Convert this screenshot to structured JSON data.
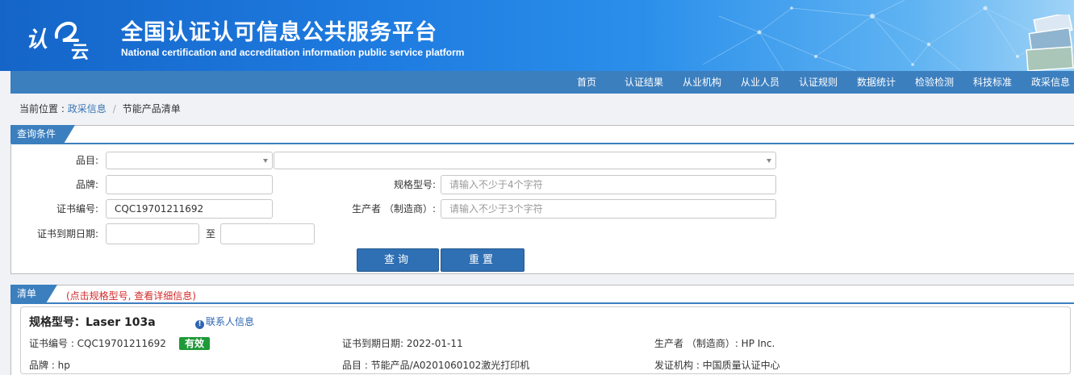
{
  "header": {
    "logo_text": "认证云",
    "title": "全国认证认可信息公共服务平台",
    "subtitle": "National certification and accreditation information public service platform"
  },
  "nav": {
    "items": [
      "首页",
      "认证结果",
      "从业机构",
      "从业人员",
      "认证规则",
      "数据统计",
      "检验检测",
      "科技标准",
      "政采信息"
    ]
  },
  "breadcrumb": {
    "prefix": "当前位置 : ",
    "link": "政采信息",
    "separator": "/",
    "current": "节能产品清单"
  },
  "query": {
    "tab_label": "查询条件",
    "category_label": "品目:",
    "brand_label": "品牌:",
    "model_label": "规格型号:",
    "model_placeholder": "请输入不少于4个字符",
    "cert_no_label": "证书编号:",
    "cert_no_value": "CQC19701211692",
    "maker_label": "生产者 （制造商）:",
    "maker_placeholder": "请输入不少于3个字符",
    "expiry_label": "证书到期日期:",
    "to_label": "至",
    "search_button": "查询",
    "reset_button": "重置"
  },
  "results": {
    "tab_label": "清单",
    "hint": "(点击规格型号, 查看详细信息)",
    "items": [
      {
        "model_title": "规格型号：Laser 103a",
        "contact_link": "联系人信息",
        "cert_no": "证书编号 : CQC19701211692",
        "status": "有效",
        "expiry": "证书到期日期: 2022-01-11",
        "maker": "生产者 （制造商）: HP Inc.",
        "brand": "品牌 : hp",
        "category": "品目 : 节能产品/A0201060102激光打印机",
        "issuer": "发证机构 : 中国质量认证中心"
      }
    ]
  },
  "colors": {
    "nav_bg": "#3c7fbf",
    "button_bg": "#2f6fb3",
    "status_valid": "#1e9a38",
    "hint_red": "#d42a2a"
  }
}
